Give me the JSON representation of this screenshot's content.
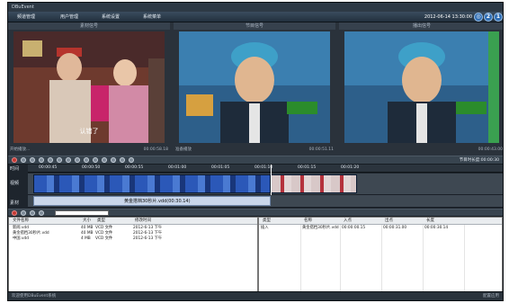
{
  "app": {
    "title": "DBuEvent"
  },
  "menu": {
    "items": [
      "频道管理",
      "用户管理",
      "系统设置",
      "系统菜单"
    ]
  },
  "header": {
    "datetime": "2012-06-14 13:30:00",
    "icons": [
      "globe-icon",
      "help-icon",
      "info-icon"
    ]
  },
  "monitors": [
    {
      "title": "素材信号",
      "status_left": "开始播放...",
      "timecode": "00:00:58.18",
      "subtitle": "认错了"
    },
    {
      "title": "节目信号",
      "status_left": "准备播放",
      "timecode": "00:00:51.11",
      "subtitle": ""
    },
    {
      "title": "播出信号",
      "status_left": "",
      "timecode": "00:00:43.00",
      "subtitle": ""
    }
  ],
  "toolbar": {
    "timecode_right": "节目时长度:00:00:30"
  },
  "timeline": {
    "track_labels": [
      "时间",
      "视频",
      "素材"
    ],
    "ticks": [
      "00:00:45",
      "00:00:50",
      "00:00:55",
      "00:01:00",
      "00:01:05",
      "00:01:10",
      "00:01:15",
      "00:01:20"
    ],
    "clip_label": "黄金搭档30秒片.vdd(00:30.14)"
  },
  "file_panel": {
    "columns": [
      "文件名称",
      "大小",
      "类型",
      "修改时间"
    ],
    "rows": [
      {
        "name": "新闻.vdd",
        "size": "40 MB",
        "type": "VCD 文件",
        "date": "2012-6-13 下午"
      },
      {
        "name": "黄金搭档30秒片.vdd",
        "size": "40 MB",
        "type": "VCD 文件",
        "date": "2012-6-13 下午"
      },
      {
        "name": "中国.vdd",
        "size": "4 MB",
        "type": "VCD 文件",
        "date": "2012-6-13 下午"
      }
    ]
  },
  "playlist_panel": {
    "columns": [
      "类型",
      "名称",
      "入点",
      "出点",
      "长度"
    ],
    "rows": [
      {
        "type": "插入",
        "name": "黄金搭档30秒片.vdd",
        "in": "00:00:00.15",
        "out": "00:00:31.00",
        "length": "00:00:30.14"
      }
    ]
  },
  "statusbar": {
    "text": "欢迎使用DBuEvent系统",
    "right": "配置应用"
  }
}
